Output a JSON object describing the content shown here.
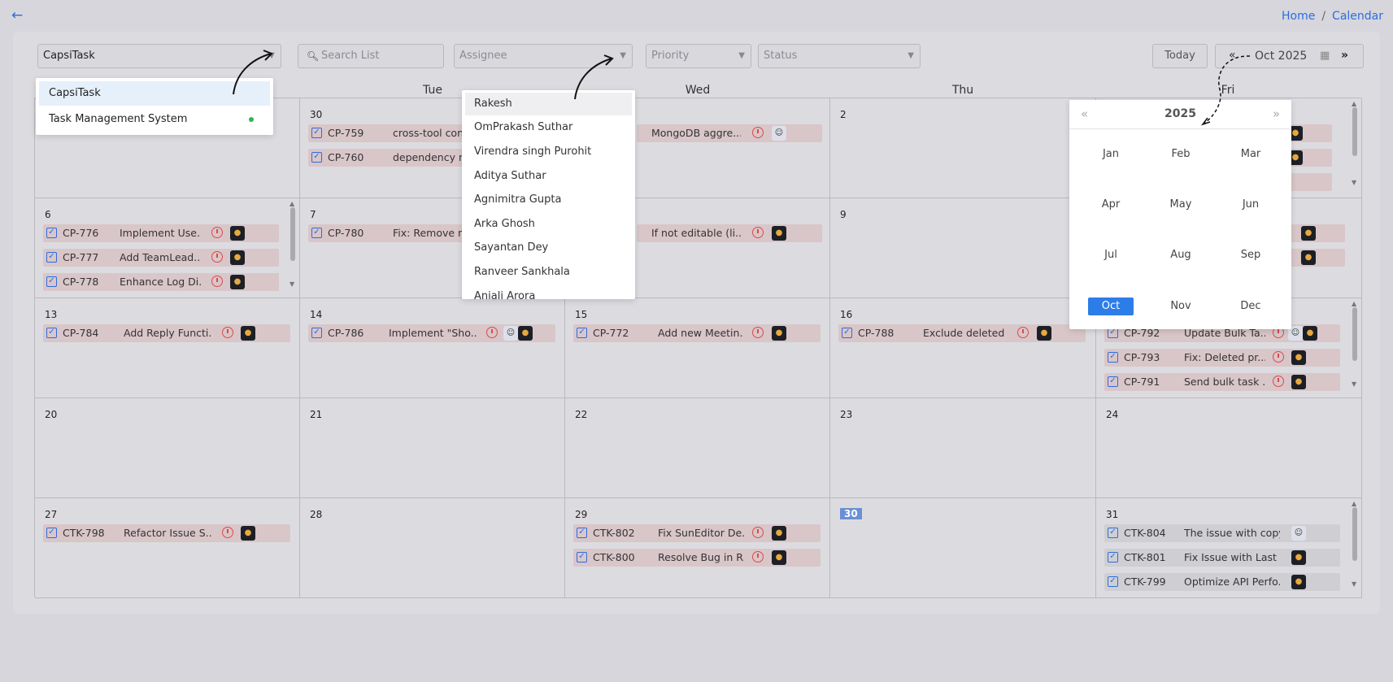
{
  "nav": {
    "back_icon": "arrow-left-icon"
  },
  "breadcrumb": {
    "home": "Home",
    "separator": "/",
    "current": "Calendar"
  },
  "filters": {
    "project_value": "CapsiTask",
    "search_placeholder": "Search List",
    "assignee_placeholder": "Assignee",
    "priority_placeholder": "Priority",
    "status_placeholder": "Status"
  },
  "toolbar": {
    "today_label": "Today",
    "prev_label": "«",
    "month_value": "Oct 2025",
    "next_label": "»"
  },
  "days": [
    "Tue",
    "Wed",
    "Thu",
    "Fri"
  ],
  "project_dropdown": {
    "options": [
      "CapsiTask",
      "Task Management System"
    ]
  },
  "assignee_dropdown": {
    "options": [
      "Rakesh",
      "OmPrakash Suthar",
      "Virendra singh Purohit",
      "Aditya Suthar",
      "Agnimitra Gupta",
      "Arka Ghosh",
      "Sayantan Dey",
      "Ranveer Sankhala",
      "Anjali Arora"
    ]
  },
  "year_picker": {
    "year": "2025",
    "prev": "«",
    "next": "»",
    "months": [
      "Jan",
      "Feb",
      "Mar",
      "Apr",
      "May",
      "Jun",
      "Jul",
      "Aug",
      "Sep",
      "Oct",
      "Nov",
      "Dec"
    ],
    "selected": "Oct"
  },
  "calendar": {
    "day_numbers": {
      "r1c2": "30",
      "r1c4": "2",
      "r2c1": "6",
      "r2c2": "7",
      "r2c4": "9",
      "r3c1": "13",
      "r3c2": "14",
      "r3c3": "15",
      "r3c4": "16",
      "r4c1": "20",
      "r4c2": "21",
      "r4c3": "22",
      "r4c4": "23",
      "r4c5": "24",
      "r5c1": "27",
      "r5c2": "28",
      "r5c3": "29",
      "r5c4": "30",
      "r5c5": "31"
    },
    "tasks": {
      "r1c2a": {
        "id": "CP-759",
        "title": "cross-tool cont"
      },
      "r1c2b": {
        "id": "CP-760",
        "title": "dependency m"
      },
      "r1c3a": {
        "title": "MongoDB aggre..."
      },
      "r2c1a": {
        "id": "CP-776",
        "title": "Implement Use..."
      },
      "r2c1b": {
        "id": "CP-777",
        "title": "Add TeamLead..."
      },
      "r2c1c": {
        "id": "CP-778",
        "title": "Enhance Log Di..."
      },
      "r2c2a": {
        "id": "CP-780",
        "title": "Fix: Remove re"
      },
      "r2c3a": {
        "title": "If not editable (li..."
      },
      "r3c1a": {
        "id": "CP-784",
        "title": "Add Reply Functi..."
      },
      "r3c2a": {
        "id": "CP-786",
        "title": "Implement \"Sho..."
      },
      "r3c3a": {
        "id": "CP-772",
        "title": "Add new Meetin..."
      },
      "r3c4a": {
        "id": "CP-788",
        "title": "Exclude deleted ..."
      },
      "r3c5a": {
        "id": "CP-792",
        "title": "Update Bulk Ta..."
      },
      "r3c5b": {
        "id": "CP-793",
        "title": "Fix: Deleted pr..."
      },
      "r3c5c": {
        "id": "CP-791",
        "title": "Send bulk task ..."
      },
      "r5c1a": {
        "id": "CTK-798",
        "title": "Refactor Issue S..."
      },
      "r5c3a": {
        "id": "CTK-802",
        "title": "Fix SunEditor De..."
      },
      "r5c3b": {
        "id": "CTK-800",
        "title": "Resolve Bug in R..."
      },
      "r5c5a": {
        "id": "CTK-804",
        "title": "The issue with copy..."
      },
      "r5c5b": {
        "id": "CTK-801",
        "title": "Fix Issue with Last ..."
      },
      "r5c5c": {
        "id": "CTK-799",
        "title": "Optimize API Perfo..."
      }
    }
  },
  "colors": {
    "accent": "#2d6cdf",
    "task_bg": "#d9c6c9",
    "today_bg": "#6b8fd4",
    "selected_month": "#2d7de8"
  }
}
